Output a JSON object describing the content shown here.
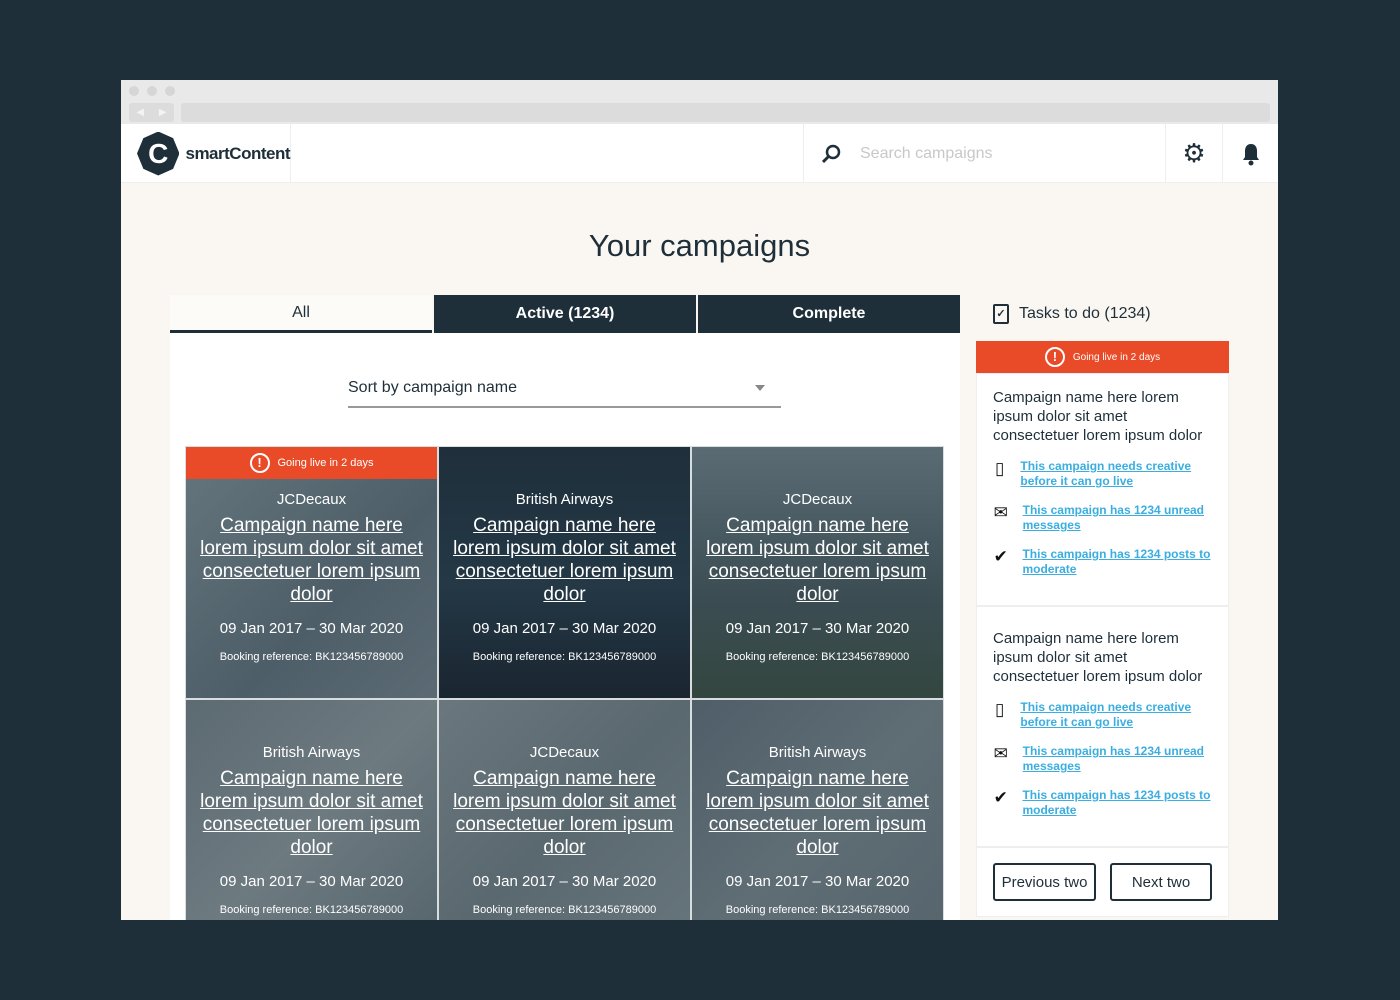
{
  "app": {
    "name": "smartContent",
    "logo_letter": "C"
  },
  "search": {
    "placeholder": "Search campaigns"
  },
  "icons": {
    "search": "search-icon",
    "settings": "gear-icon",
    "notifications": "bell-icon"
  },
  "page": {
    "title": "Your campaigns"
  },
  "tabs": [
    {
      "label": "All",
      "selected": true
    },
    {
      "label": "Active (1234)",
      "selected": false
    },
    {
      "label": "Complete",
      "selected": false
    }
  ],
  "sort": {
    "value": "Sort by campaign name"
  },
  "colors": {
    "primary": "#1e2f3a",
    "alert": "#e94a27",
    "link": "#3aaee0"
  },
  "campaigns": [
    {
      "alert": "Going live in 2 days",
      "brand": "JCDecaux",
      "name": "Campaign name here lorem ipsum dolor sit amet consectetuer lorem ipsum dolor",
      "dates": "09 Jan 2017 – 30 Mar 2020",
      "ref": "Booking reference: BK123456789000"
    },
    {
      "brand": "British Airways",
      "name": "Campaign name here lorem ipsum dolor sit amet consectetuer lorem ipsum dolor",
      "dates": "09 Jan 2017 – 30 Mar 2020",
      "ref": "Booking reference: BK123456789000"
    },
    {
      "brand": "JCDecaux",
      "name": "Campaign name here lorem ipsum dolor sit amet consectetuer lorem ipsum dolor",
      "dates": "09 Jan 2017 – 30 Mar 2020",
      "ref": "Booking reference: BK123456789000"
    },
    {
      "brand": "British Airways",
      "name": "Campaign name here lorem ipsum dolor sit amet consectetuer lorem ipsum dolor",
      "dates": "09 Jan 2017 – 30 Mar 2020",
      "ref": "Booking reference: BK123456789000"
    },
    {
      "brand": "JCDecaux",
      "name": "Campaign name here lorem ipsum dolor sit amet consectetuer lorem ipsum dolor",
      "dates": "09 Jan 2017 – 30 Mar 2020",
      "ref": "Booking reference: BK123456789000"
    },
    {
      "brand": "British Airways",
      "name": "Campaign name here lorem ipsum dolor sit amet consectetuer lorem ipsum dolor",
      "dates": "09 Jan 2017 – 30 Mar 2020",
      "ref": "Booking reference: BK123456789000"
    }
  ],
  "tasks": {
    "title": "Tasks to do (1234)",
    "alert": "Going live in 2 days",
    "items": [
      {
        "name": "Campaign name here lorem ipsum dolor sit amet consectetuer lorem ipsum dolor",
        "creative": "This campaign needs creative before it can go live",
        "messages": "This campaign has 1234 unread messages",
        "moderate": "This campaign has 1234 posts to moderate"
      },
      {
        "name": "Campaign name here lorem ipsum dolor sit amet consectetuer lorem ipsum dolor",
        "creative": "This campaign needs creative before it can go live",
        "messages": "This campaign has 1234 unread messages",
        "moderate": "This campaign has 1234 posts to moderate"
      }
    ],
    "prev_label": "Previous two",
    "next_label": "Next two"
  }
}
